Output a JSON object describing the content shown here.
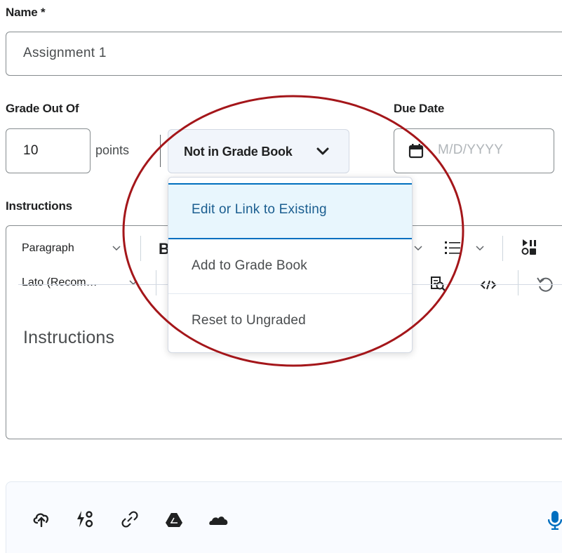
{
  "form": {
    "name_label": "Name *",
    "name_value": "Assignment 1",
    "grade_label": "Grade Out Of",
    "grade_value": "10",
    "points_label": "points",
    "gradebook_button": "Not in Grade Book",
    "due_label": "Due Date",
    "due_placeholder": "M/D/YYYY",
    "instructions_label": "Instructions"
  },
  "editor": {
    "format_select": "Paragraph",
    "font_select": "Lato (Recom…",
    "placeholder": "Instructions",
    "bold_glyph": "B"
  },
  "dropdown": {
    "items": [
      {
        "label": "Edit or Link to Existing",
        "highlighted": true
      },
      {
        "label": "Add to Grade Book"
      },
      {
        "label": "Reset to Ungraded"
      }
    ]
  },
  "attachments": {
    "icons": [
      "upload-icon",
      "insert-stuff-icon",
      "link-icon",
      "google-drive-icon",
      "onedrive-icon",
      "microphone-icon"
    ]
  },
  "colors": {
    "annotation": "#a4161a",
    "highlight_bg": "#e8f6fd",
    "highlight_border": "#006fbf",
    "link_text": "#1b5e90"
  }
}
